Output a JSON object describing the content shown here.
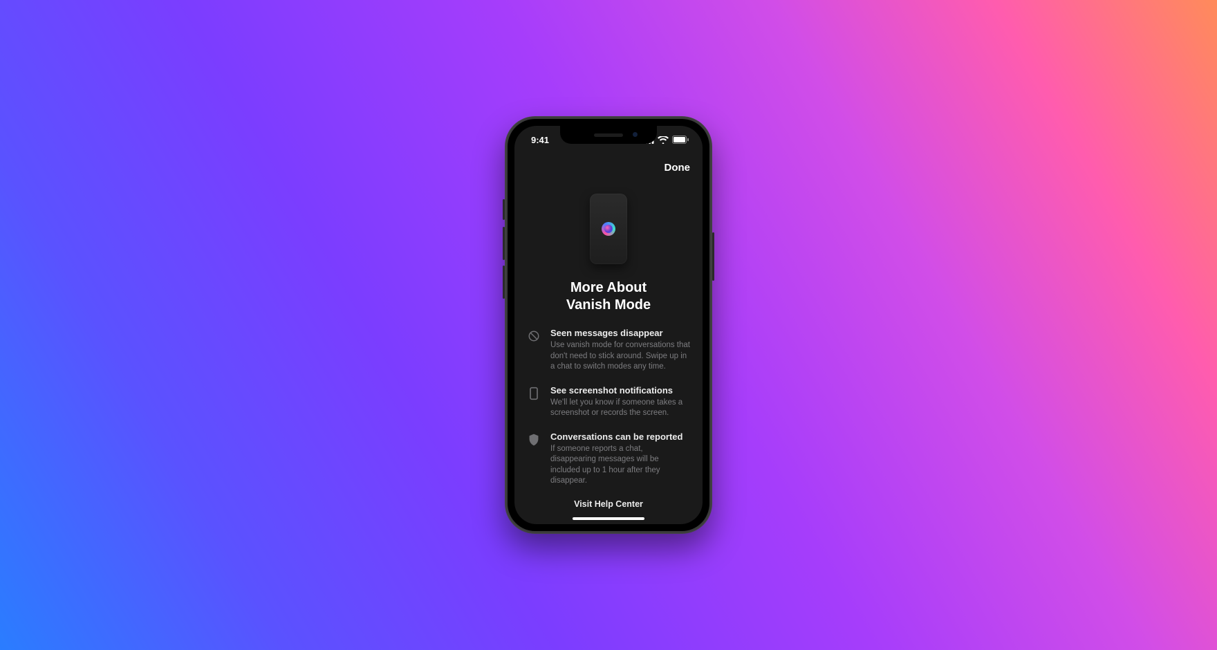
{
  "statusbar": {
    "time": "9:41"
  },
  "nav": {
    "done": "Done"
  },
  "page": {
    "title": "More About Vanish Mode",
    "helpLink": "Visit Help Center"
  },
  "features": [
    {
      "icon": "no-entry-icon",
      "title": "Seen messages disappear",
      "body": "Use vanish mode for conversations that don't need to stick around. Swipe up in a chat to switch modes any time."
    },
    {
      "icon": "phone-outline-icon",
      "title": "See screenshot notifications",
      "body": "We'll let you know if someone takes a screenshot or records the screen."
    },
    {
      "icon": "shield-icon",
      "title": "Conversations can be reported",
      "body": "If someone reports a chat, disappearing messages will be included up to 1 hour after they disappear."
    }
  ]
}
